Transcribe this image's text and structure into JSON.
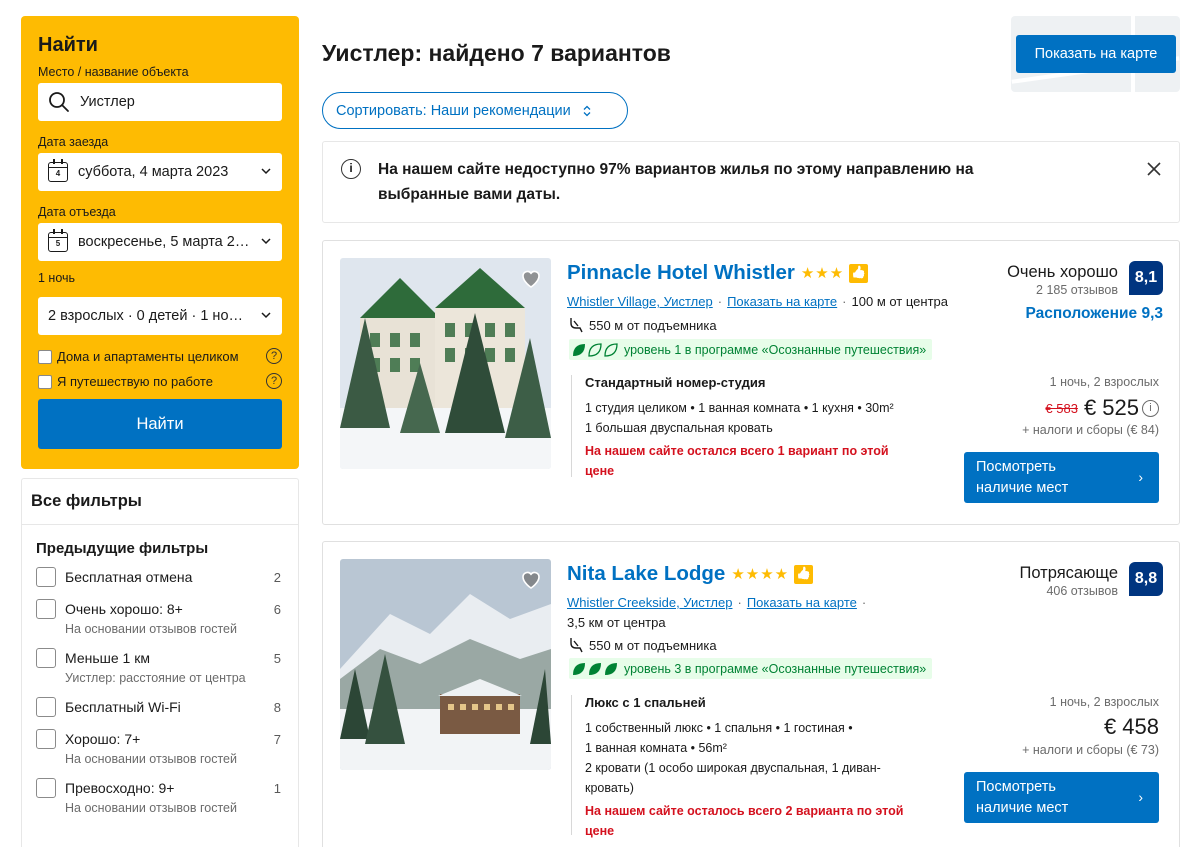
{
  "search": {
    "title": "Найти",
    "destination_label": "Место / название объекта",
    "destination_value": "Уистлер",
    "checkin_label": "Дата заезда",
    "checkin_day": "4",
    "checkin_value": "суббота, 4 марта 2023",
    "checkout_label": "Дата отъезда",
    "checkout_day": "5",
    "checkout_value": "воскресенье, 5 марта 2…",
    "nights": "1 ночь",
    "guests_value": "2 взрослых · 0 детей · 1 но…",
    "option_homes": "Дома и апартаменты целиком",
    "option_work": "Я путешествую по работе",
    "submit_label": "Найти"
  },
  "filters": {
    "title": "Все фильтры",
    "group_title": "Предыдущие фильтры",
    "items": [
      {
        "label": "Бесплатная отмена",
        "sub": "",
        "count": "2"
      },
      {
        "label": "Очень хорошо: 8+",
        "sub": "На основании отзывов гостей",
        "count": "6"
      },
      {
        "label": "Меньше 1 км",
        "sub": "Уистлер: расстояние от центра",
        "count": "5"
      },
      {
        "label": "Бесплатный Wi-Fi",
        "sub": "",
        "count": "8"
      },
      {
        "label": "Хорошо: 7+",
        "sub": "На основании отзывов гостей",
        "count": "7"
      },
      {
        "label": "Превосходно: 9+",
        "sub": "На основании отзывов гостей",
        "count": "1"
      }
    ]
  },
  "header": {
    "title": "Уистлер: найдено 7 вариантов",
    "map_button": "Показать на карте",
    "sort_label": "Сортировать: Наши рекомендации"
  },
  "notice": {
    "text": "На нашем сайте недоступно 97% вариантов жилья по этому направлению на выбранные вами даты."
  },
  "properties": [
    {
      "name": "Pinnacle Hotel Whistler",
      "stars": "★★★",
      "area": "Whistler Village, Уистлер",
      "map_link": "Показать на карте",
      "distance": "100 м от центра",
      "lift": "550 м от подъемника",
      "sustainability": "уровень 1 в программе «Осознанные путешествия»",
      "rating_word": "Очень хорошо",
      "rating_count": "2 185 отзывов",
      "score": "8,1",
      "location_score": "Расположение 9,3",
      "room_title": "Стандартный номер-студия",
      "room_lines": [
        "1 студия целиком • 1 ванная комната • 1 кухня • 30m²",
        "1 большая двуспальная кровать"
      ],
      "scarcity": "На нашем сайте остался всего 1 вариант по этой цене",
      "price_meta": "1 ночь, 2 взрослых",
      "old_price": "€ 583",
      "price": "€ 525",
      "taxes": "+ налоги и сборы (€ 84)",
      "button": "Посмотреть наличие мест"
    },
    {
      "name": "Nita Lake Lodge",
      "stars": "★★★★",
      "area": "Whistler Creekside, Уистлер",
      "map_link": "Показать на карте",
      "distance": "3,5 км от центра",
      "lift": "550 м от подъемника",
      "sustainability": "уровень 3 в программе «Осознанные путешествия»",
      "rating_word": "Потрясающе",
      "rating_count": "406 отзывов",
      "score": "8,8",
      "room_title": "Люкс с 1 спальней",
      "room_lines": [
        "1 собственный люкс • 1 спальня • 1 гостиная •",
        "1 ванная комната • 56m²",
        "2 кровати (1 особо широкая двуспальная, 1 диван-",
        "кровать)"
      ],
      "scarcity": "На нашем сайте осталось всего 2 варианта по этой цене",
      "price_meta": "1 ночь, 2 взрослых",
      "price": "€ 458",
      "taxes": "+ налоги и сборы (€ 73)",
      "button": "Посмотреть наличие мест"
    }
  ]
}
